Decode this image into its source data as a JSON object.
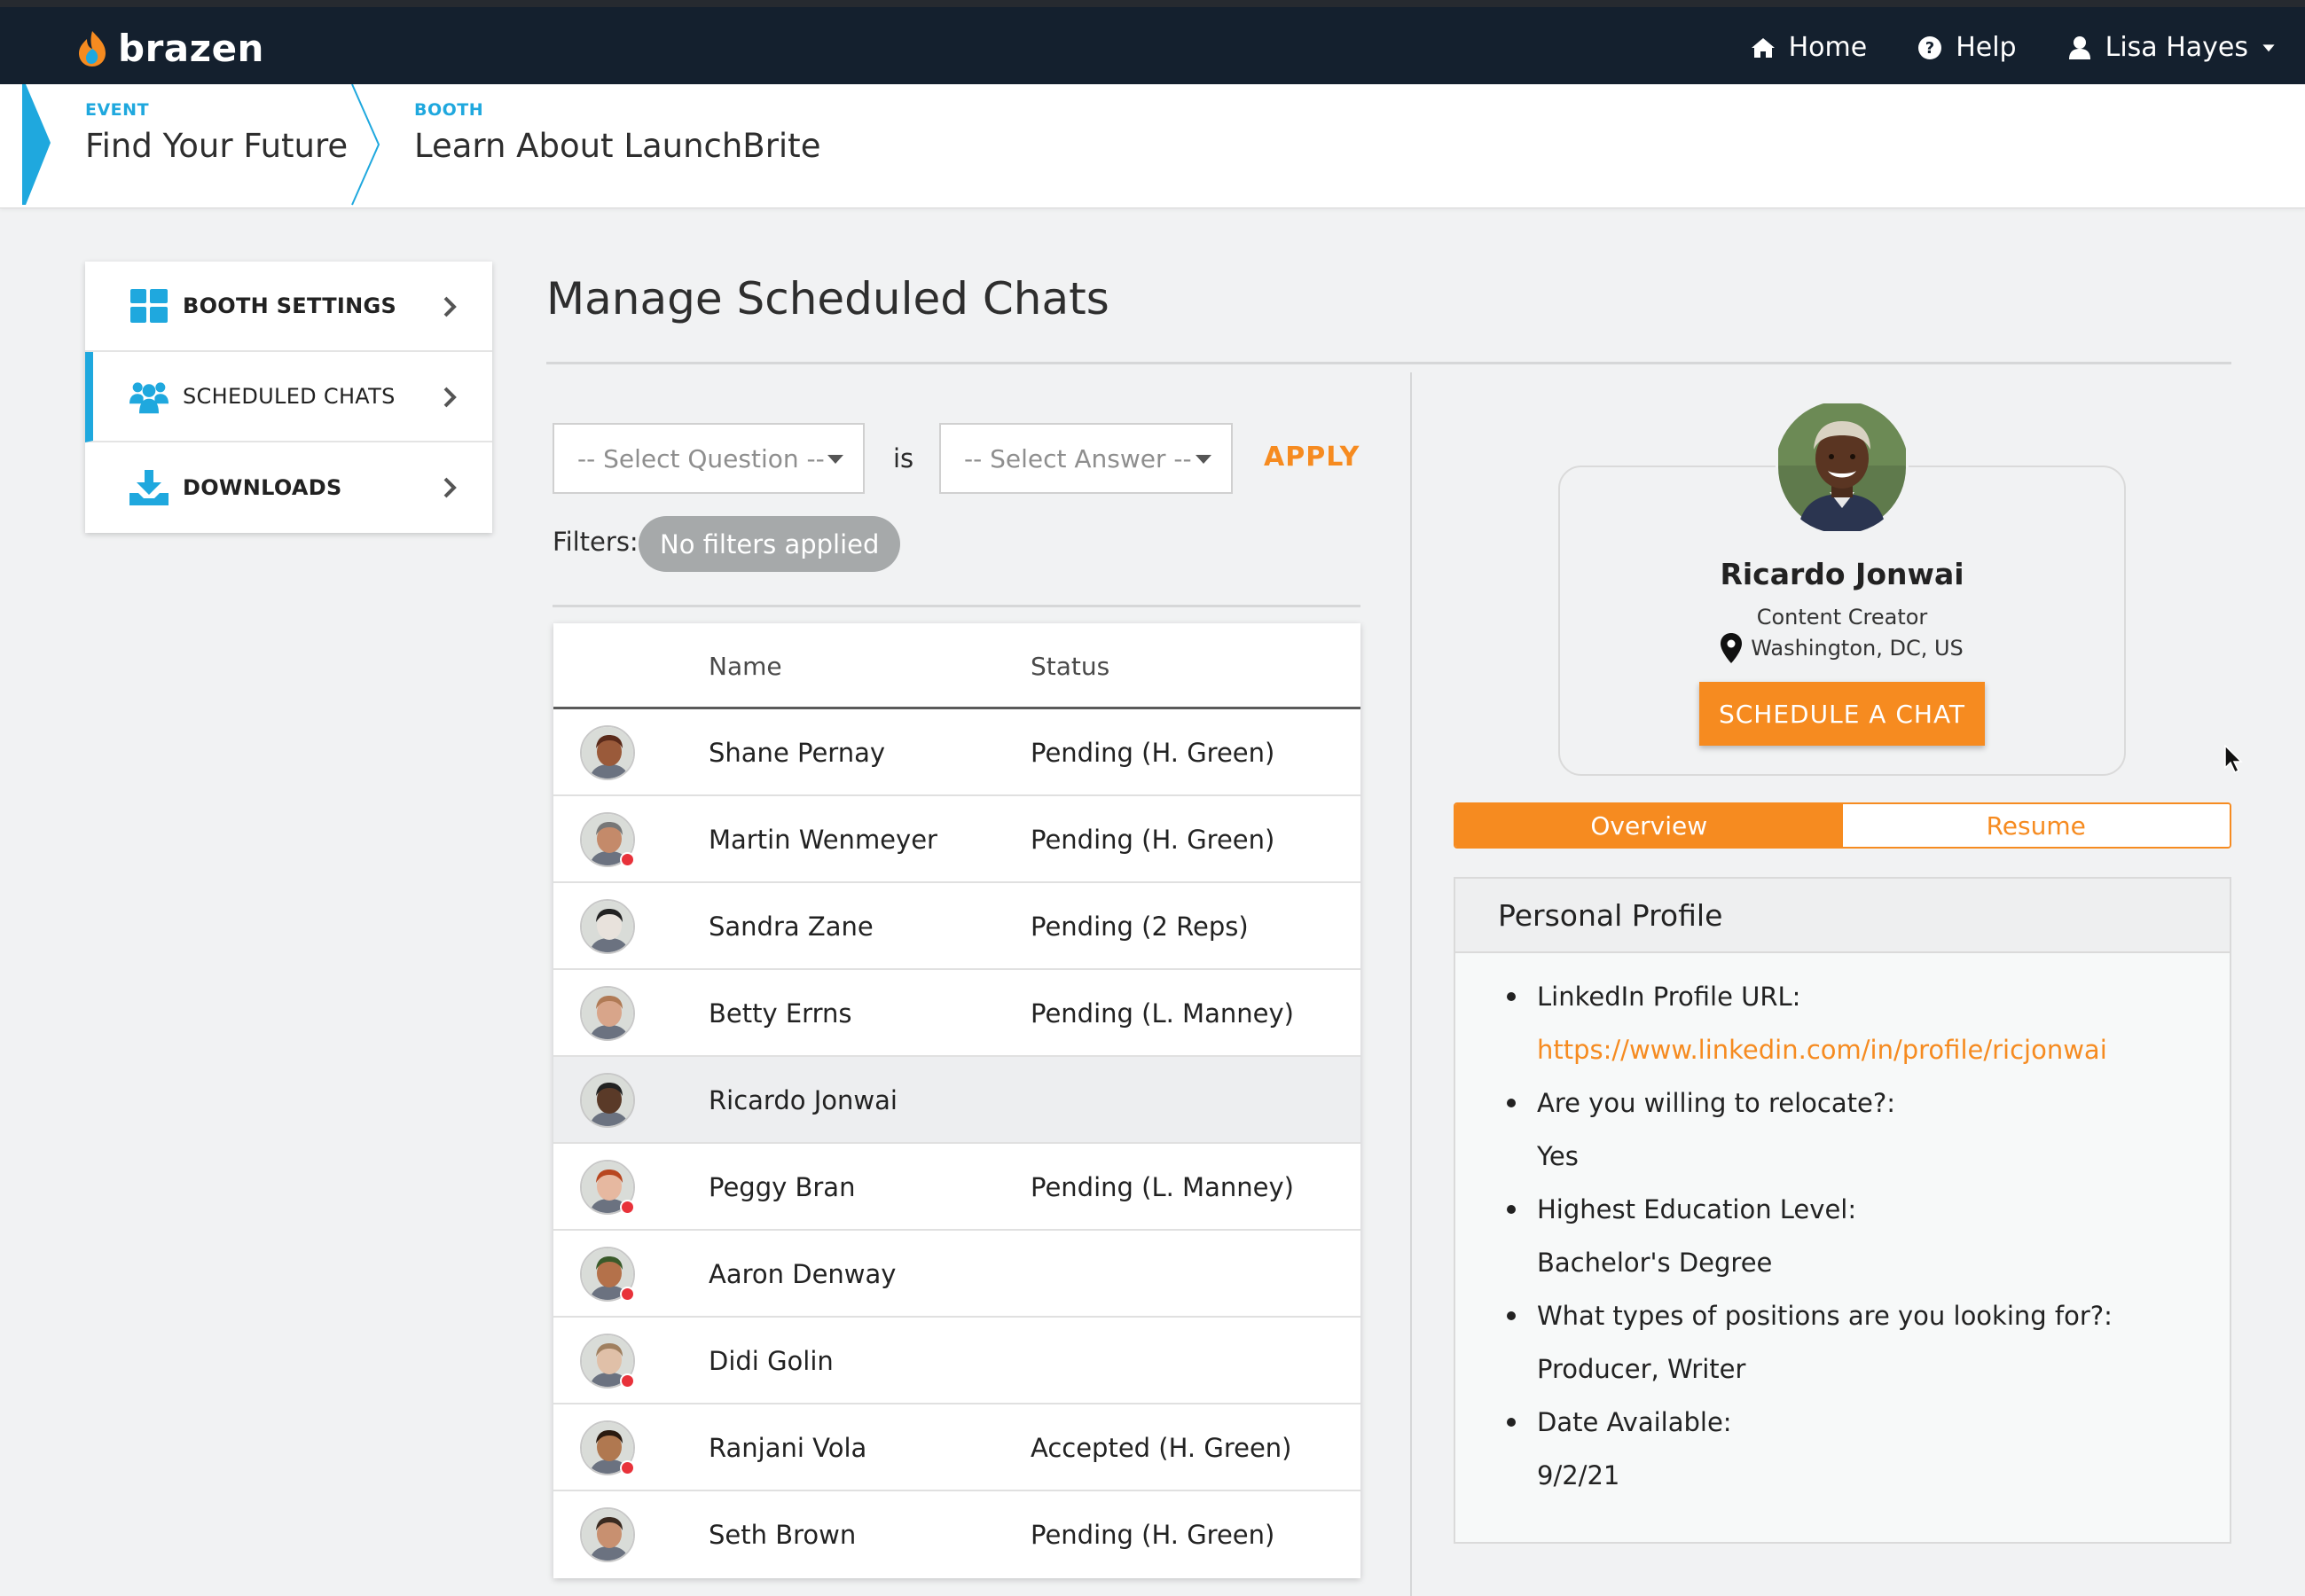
{
  "nav": {
    "brand": "brazen",
    "home": "Home",
    "help": "Help",
    "user": "Lisa Hayes"
  },
  "breadcrumb": {
    "event_label": "EVENT",
    "event_name": "Find Your Future",
    "booth_label": "BOOTH",
    "booth_name": "Learn About LaunchBrite"
  },
  "sidebar": {
    "items": [
      {
        "label": "BOOTH SETTINGS",
        "icon": "grid-icon"
      },
      {
        "label": "SCHEDULED CHATS",
        "icon": "people-icon",
        "active": true
      },
      {
        "label": "DOWNLOADS",
        "icon": "download-icon"
      }
    ]
  },
  "main": {
    "title": "Manage Scheduled Chats",
    "question_placeholder": "-- Select Question --",
    "is_label": "is",
    "answer_placeholder": "-- Select Answer --",
    "apply_label": "APPLY",
    "filters_label": "Filters:",
    "filters_value": "No filters applied",
    "columns": {
      "name": "Name",
      "status": "Status"
    },
    "rows": [
      {
        "name": "Shane Pernay",
        "status": "Pending (H. Green)",
        "online": false,
        "skin": "#9a5a3a",
        "hair": "#5a2a1a"
      },
      {
        "name": "Martin Wenmeyer",
        "status": "Pending (H. Green)",
        "online": true,
        "skin": "#c48a6a",
        "hair": "#777777"
      },
      {
        "name": "Sandra Zane",
        "status": "Pending (2 Reps)",
        "online": false,
        "skin": "#e8e2dc",
        "hair": "#222222"
      },
      {
        "name": "Betty Errns",
        "status": "Pending (L. Manney)",
        "online": false,
        "skin": "#d8a58a",
        "hair": "#b07a55"
      },
      {
        "name": "Ricardo Jonwai",
        "status": "",
        "online": false,
        "skin": "#5a3a28",
        "hair": "#222222",
        "selected": true
      },
      {
        "name": "Peggy Bran",
        "status": "Pending (L. Manney)",
        "online": true,
        "skin": "#e6b8a0",
        "hair": "#b8461f"
      },
      {
        "name": "Aaron Denway",
        "status": "",
        "online": true,
        "skin": "#b4714a",
        "hair": "#3a5a2a"
      },
      {
        "name": "Didi Golin",
        "status": "",
        "online": true,
        "skin": "#e0c0a8",
        "hair": "#a08060"
      },
      {
        "name": "Ranjani Vola",
        "status": "Accepted (H. Green)",
        "online": true,
        "skin": "#b07850",
        "hair": "#2a1a10"
      },
      {
        "name": "Seth Brown",
        "status": "Pending (H. Green)",
        "online": false,
        "skin": "#c89070",
        "hair": "#3a2a20"
      }
    ]
  },
  "profile": {
    "name": "Ricardo Jonwai",
    "title": "Content Creator",
    "location": "Washington, DC, US",
    "schedule_label": "SCHEDULE A CHAT",
    "tabs": {
      "overview": "Overview",
      "resume": "Resume"
    },
    "panel_title": "Personal Profile",
    "fields": [
      {
        "q": "LinkedIn Profile URL:",
        "a": "https://www.linkedin.com/in/profile/ricjonwai",
        "link": true
      },
      {
        "q": "Are you willing to relocate?:",
        "a": "Yes"
      },
      {
        "q": "Highest Education Level:",
        "a": "Bachelor's Degree"
      },
      {
        "q": "What types of positions are you looking for?:",
        "a": "Producer, Writer"
      },
      {
        "q": "Date Available:",
        "a": "9/2/21"
      }
    ]
  },
  "colors": {
    "accent": "#f68b20",
    "brand_blue": "#1fa8de",
    "nav_bg": "#14202e",
    "online_dot": "#e8323a"
  }
}
